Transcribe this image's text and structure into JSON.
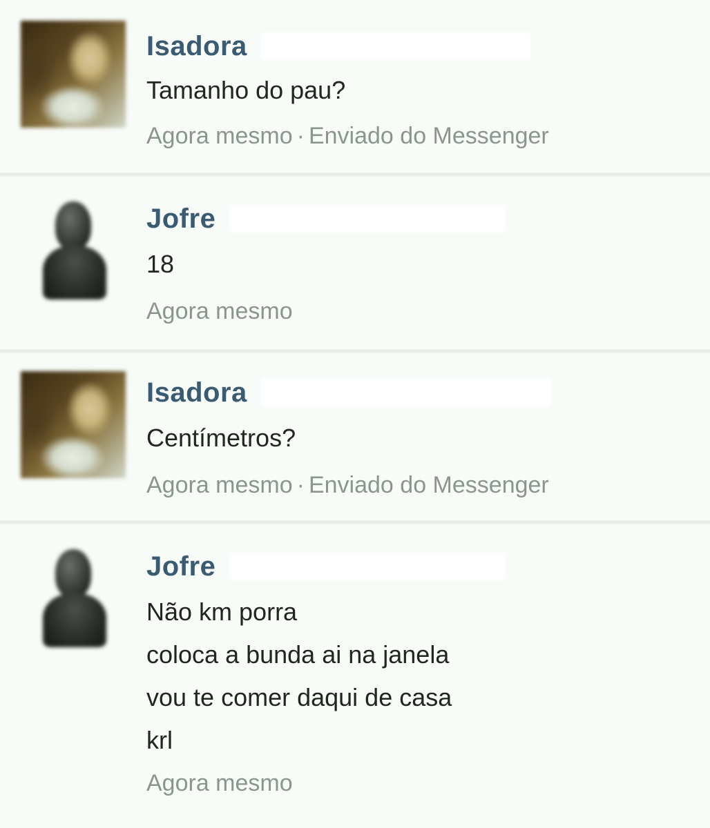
{
  "messages": [
    {
      "sender": "Isadora",
      "avatar_icon": "profile-photo-isadora",
      "lines": [
        "Tamanho do pau?"
      ],
      "time": "Agora mesmo",
      "separator": "·",
      "via": "Enviado do Messenger"
    },
    {
      "sender": "Jofre",
      "avatar_icon": "profile-photo-jofre",
      "lines": [
        "18"
      ],
      "time": "Agora mesmo"
    },
    {
      "sender": "Isadora",
      "avatar_icon": "profile-photo-isadora",
      "lines": [
        "Centímetros?"
      ],
      "time": "Agora mesmo",
      "separator": "·",
      "via": "Enviado do Messenger"
    },
    {
      "sender": "Jofre",
      "avatar_icon": "profile-photo-jofre",
      "lines": [
        "Não km porra",
        "coloca a bunda ai na janela",
        "vou te comer daqui de casa",
        "krl"
      ],
      "time": "Agora mesmo"
    }
  ],
  "colors": {
    "name": "#3b5b72",
    "text": "#222622",
    "meta": "#8b968b",
    "background": "#f8fcf8"
  }
}
